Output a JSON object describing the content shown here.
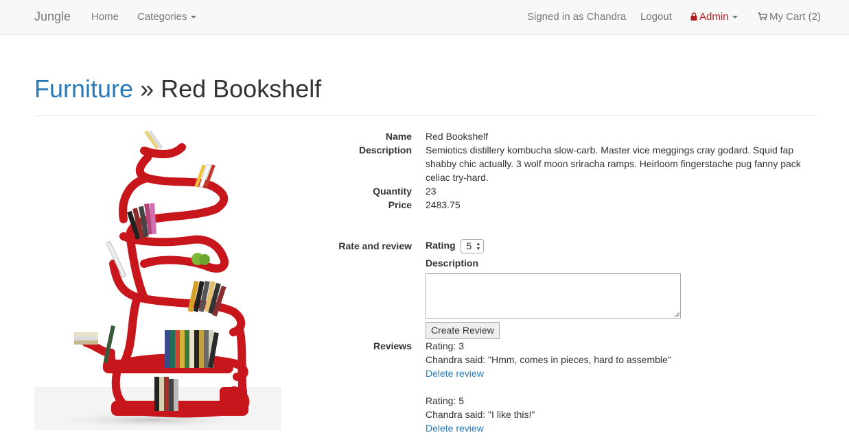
{
  "nav": {
    "brand": "Jungle",
    "home": "Home",
    "categories": "Categories",
    "signed_in": "Signed in as Chandra",
    "logout": "Logout",
    "admin": "Admin",
    "cart": "My Cart (2)"
  },
  "header": {
    "category": "Furniture",
    "separator": " » ",
    "product": "Red Bookshelf"
  },
  "details": {
    "name_label": "Name",
    "name": "Red Bookshelf",
    "description_label": "Description",
    "description": "Semiotics distillery kombucha slow-carb. Master vice meggings cray godard. Squid fap shabby chic actually. 3 wolf moon sriracha ramps. Heirloom fingerstache pug fanny pack celiac try-hard.",
    "quantity_label": "Quantity",
    "quantity": "23",
    "price_label": "Price",
    "price": "2483.75"
  },
  "review_form": {
    "section_label": "Rate and review",
    "rating_label": "Rating",
    "rating_value": "5",
    "description_label": "Description",
    "description_value": "",
    "submit_label": "Create Review"
  },
  "reviews": {
    "label": "Reviews",
    "items": [
      {
        "rating": "Rating: 3",
        "text": "Chandra said: \"Hmm, comes in pieces, hard to assemble\"",
        "delete": "Delete review"
      },
      {
        "rating": "Rating: 5",
        "text": "Chandra said: \"I like this!\"",
        "delete": "Delete review"
      }
    ]
  },
  "colors": {
    "link": "#2a7ab9",
    "admin": "#b31e1e",
    "shelf": "#c8161d"
  }
}
